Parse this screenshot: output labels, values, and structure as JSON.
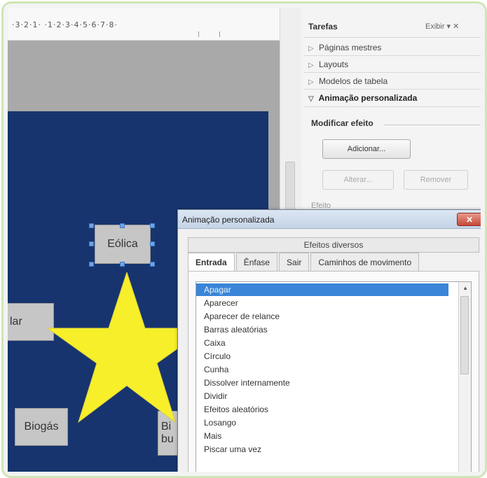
{
  "ruler": {
    "text": "·3·2·1· ·1·2·3·4·5·6·7·8·"
  },
  "slide": {
    "shapes": {
      "eolica": "Eólica",
      "solar_partial": "lar",
      "biogas": "Biogás",
      "bio_partial_line1": "Bi",
      "bio_partial_line2": "bu"
    },
    "star_color": "#f7ef2a",
    "background_color": "#17346e"
  },
  "task_pane": {
    "title": "Tarefas",
    "view_menu": "Exibir ▾ ✕",
    "items": [
      {
        "label": "Páginas mestres",
        "expanded": false
      },
      {
        "label": "Layouts",
        "expanded": false
      },
      {
        "label": "Modelos de tabela",
        "expanded": false
      },
      {
        "label": "Animação personalizada",
        "expanded": true
      }
    ],
    "modify_effect_heading": "Modificar efeito",
    "add_button": "Adicionar...",
    "change_button": "Alterar...",
    "remove_button": "Remover",
    "effect_label": "Efeito"
  },
  "dialog": {
    "title": "Animação personalizada",
    "close_label": "✕",
    "group_tab": "Efeitos diversos",
    "tabs": [
      "Entrada",
      "Ênfase",
      "Sair",
      "Caminhos de movimento"
    ],
    "selected_tab": "Entrada",
    "effects": [
      "Apagar",
      "Aparecer",
      "Aparecer de relance",
      "Barras aleatórias",
      "Caixa",
      "Círculo",
      "Cunha",
      "Dissolver internamente",
      "Dividir",
      "Efeitos aleatórios",
      "Losango",
      "Mais",
      "Piscar uma vez"
    ],
    "selected_effect": "Apagar",
    "accent_color": "#3a85d8"
  }
}
